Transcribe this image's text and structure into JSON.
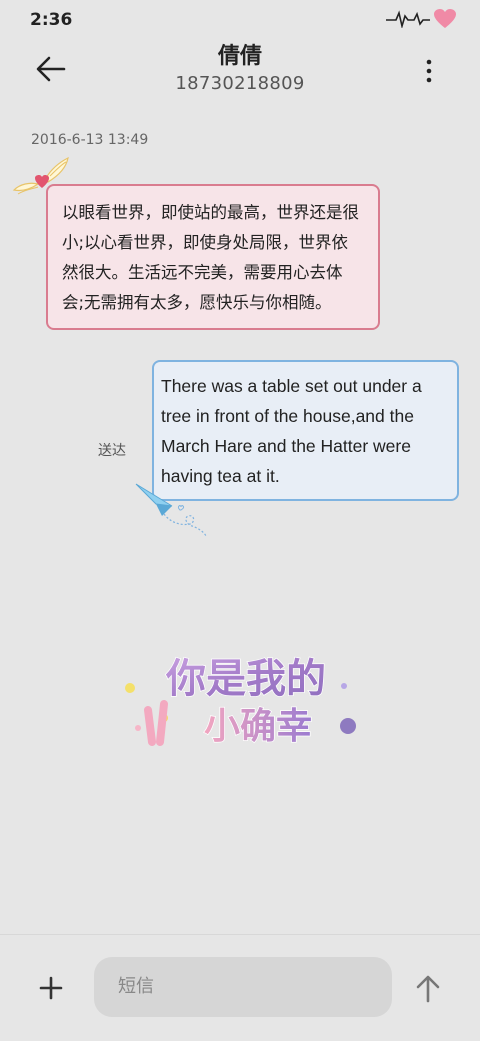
{
  "status_bar": {
    "time": "2:36",
    "icons": [
      "heartbeat-icon",
      "heart-icon"
    ]
  },
  "header": {
    "contact_name": "倩倩",
    "contact_number": "18730218809",
    "back_icon": "arrow-left-icon",
    "more_icon": "more-vertical-icon"
  },
  "conversation": {
    "timestamp": "2016-6-13 13:49",
    "messages": [
      {
        "direction": "incoming",
        "text": "以眼看世界，即使站的最高，世界还是很小;以心看世界，即使身处局限，世界依然很大。生活远不完美，需要用心去体会;无需拥有太多，愿快乐与你相随。"
      },
      {
        "direction": "outgoing",
        "text": "There was a table set out under a tree in front of the house,and the March Hare and the Hatter were having tea at it.",
        "status": "送达"
      }
    ],
    "sticker": {
      "line1": "你是我的",
      "line2": "小确幸"
    }
  },
  "composer": {
    "placeholder": "短信",
    "add_icon": "plus-icon",
    "send_icon": "arrow-up-icon"
  },
  "colors": {
    "background": "#e6e6e6",
    "incoming_bubble": "#f7e4e8",
    "incoming_border": "#d97c8f",
    "outgoing_bubble": "#e8eef6",
    "outgoing_border": "#7fb3e0",
    "heart": "#f08aa6"
  }
}
